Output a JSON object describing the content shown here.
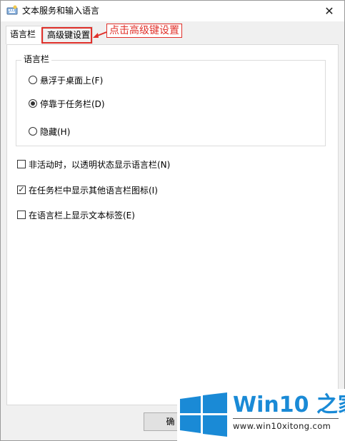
{
  "window": {
    "title": "文本服务和输入语言",
    "close_glyph": "✕"
  },
  "tabs": [
    {
      "label": "语言栏",
      "active": true
    },
    {
      "label": "高级键设置",
      "active": false
    }
  ],
  "annotation": {
    "text": "点击高级键设置",
    "color": "#e0302a"
  },
  "language_bar_group": {
    "legend": "语言栏",
    "options": [
      {
        "label": "悬浮于桌面上(F)",
        "checked": false
      },
      {
        "label": "停靠于任务栏(D)",
        "checked": true
      },
      {
        "label": "隐藏(H)",
        "checked": false
      }
    ]
  },
  "checkboxes": [
    {
      "label": "非活动时，以透明状态显示语言栏(N)",
      "checked": false
    },
    {
      "label": "在任务栏中显示其他语言栏图标(I)",
      "checked": true
    },
    {
      "label": "在语言栏上显示文本标签(E)",
      "checked": false
    }
  ],
  "buttons": {
    "ok_visible": "确"
  },
  "watermark": {
    "brand_latin": "Win10",
    "brand_zh": "之家",
    "url": "www.win10xitong.com",
    "accent": "#1a8ad6"
  }
}
